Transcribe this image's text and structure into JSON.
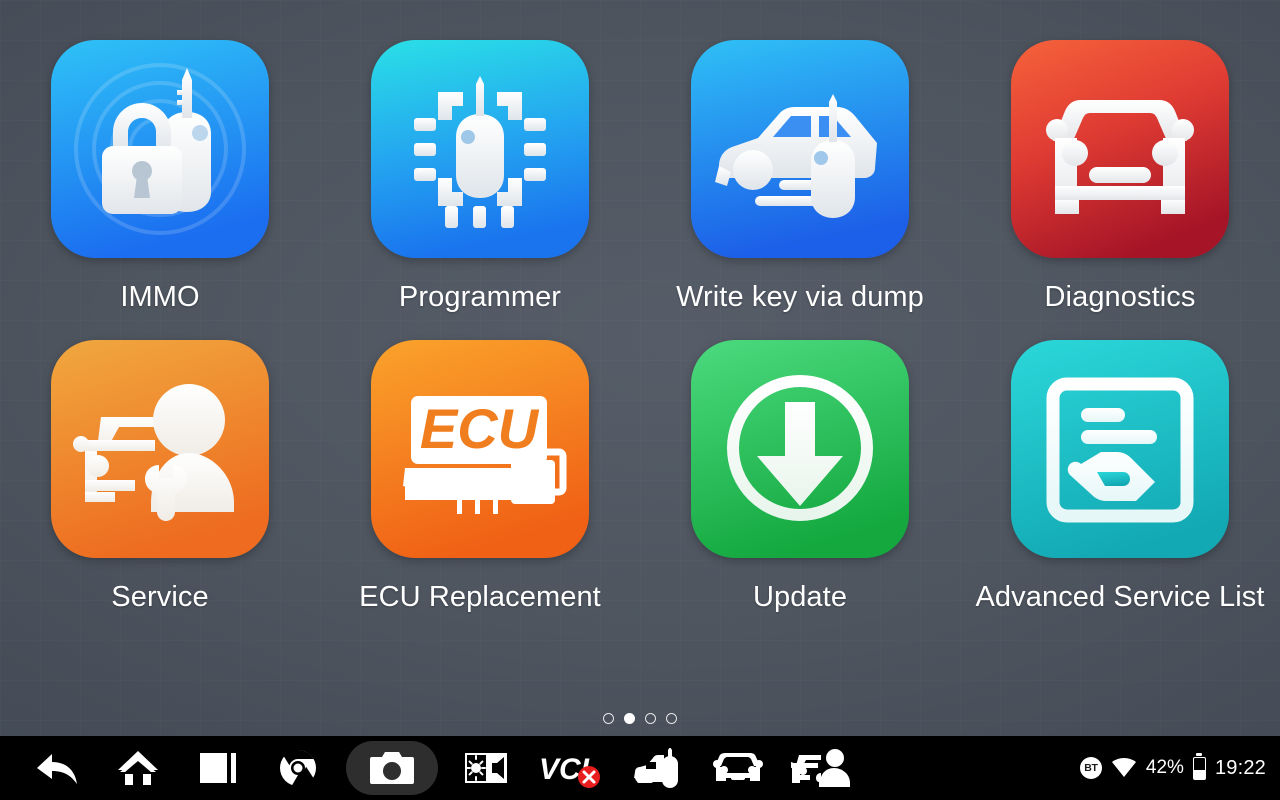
{
  "screen": {
    "title": "Automotive Diagnostic Tablet Home",
    "background_color": "#4e555f",
    "page_indicator": {
      "total": 4,
      "active_index": 1
    }
  },
  "apps": [
    {
      "id": "immo",
      "label": "IMMO",
      "icon": "lock-and-key-icon",
      "gradient_from": "#2ec2f7",
      "gradient_to": "#1b6ef0"
    },
    {
      "id": "programmer",
      "label": "Programmer",
      "icon": "chip-key-icon",
      "gradient_from": "#2ae0e6",
      "gradient_to": "#1a74ee"
    },
    {
      "id": "write-key-via-dump",
      "label": "Write key via dump",
      "icon": "car-key-icon",
      "gradient_from": "#2fc0f6",
      "gradient_to": "#1c5fe8"
    },
    {
      "id": "diagnostics",
      "label": "Diagnostics",
      "icon": "car-front-icon",
      "gradient_from": "#f4603a",
      "gradient_to": "#a61527"
    },
    {
      "id": "service",
      "label": "Service",
      "icon": "mechanic-icon",
      "gradient_from": "#f0a63e",
      "gradient_to": "#ee6b1f"
    },
    {
      "id": "ecu-replacement",
      "label": "ECU Replacement",
      "icon": "ecu-module-icon",
      "icon_text": "ECU",
      "gradient_from": "#faa12b",
      "gradient_to": "#f06015"
    },
    {
      "id": "update",
      "label": "Update",
      "icon": "download-circle-icon",
      "gradient_from": "#4ad97d",
      "gradient_to": "#14a83f"
    },
    {
      "id": "advanced-service-list",
      "label": "Advanced Service List",
      "icon": "service-list-hand-icon",
      "gradient_from": "#2ad6d8",
      "gradient_to": "#13a9b4"
    }
  ],
  "taskbar": {
    "buttons": [
      {
        "id": "back",
        "icon": "back-arrow-icon",
        "label": "Back"
      },
      {
        "id": "home",
        "icon": "home-icon",
        "label": "Home"
      },
      {
        "id": "recents",
        "icon": "recent-apps-icon",
        "label": "Recent apps"
      },
      {
        "id": "browser",
        "icon": "chrome-browser-icon",
        "label": "Browser"
      },
      {
        "id": "screenshot",
        "icon": "camera-icon",
        "label": "Screenshot",
        "highlighted": true
      },
      {
        "id": "display",
        "icon": "brightness-volume-icon",
        "label": "Brightness and volume"
      },
      {
        "id": "vci",
        "icon": "vci-icon",
        "label": "VCI",
        "text": "VCI",
        "status": "disconnected",
        "status_badge": "×"
      },
      {
        "id": "key-tool",
        "icon": "car-key-tool-icon",
        "label": "Key tool"
      },
      {
        "id": "car",
        "icon": "car-front-small-icon",
        "label": "Vehicle"
      },
      {
        "id": "service-tool",
        "icon": "car-service-icon",
        "label": "Service"
      }
    ],
    "status": {
      "bluetooth_label": "BT",
      "wifi_icon": "wifi-icon",
      "battery_percent": "42%",
      "battery_level": 42,
      "battery_icon": "battery-icon",
      "clock": "19:22"
    }
  }
}
